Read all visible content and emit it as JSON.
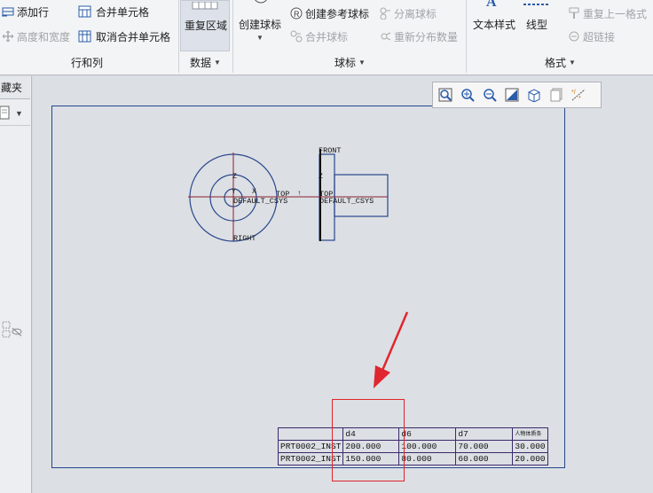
{
  "ribbon": {
    "rows_cols": {
      "add_row": "添加行",
      "height_width": "高度和宽度",
      "merge_cells": "合并单元格",
      "unmerge_cells": "取消合并单元格",
      "group_label": "行和列"
    },
    "data": {
      "repeat_region": "重复区域",
      "group_label": "数据"
    },
    "balloons": {
      "create_balloon": "创建球标",
      "create_ref_balloon": "创建参考球标",
      "merge_balloon": "合并球标",
      "detach_balloon": "分离球标",
      "redistribute_qty": "重新分布数量",
      "group_label": "球标"
    },
    "format": {
      "text_style": "文本样式",
      "line_style": "线型",
      "repeat_last_format": "重复上一格式",
      "hyperlink": "超链接",
      "group_label": "格式"
    }
  },
  "left_panel": {
    "tab_label": "藏夹"
  },
  "drawing": {
    "labels": {
      "front": "FRONT",
      "right": "RIGHT",
      "top": "TOP",
      "default_csys_left": "DEFAULT_CSYS",
      "default_csys_right": "DEFAULT_CSYS",
      "top_right_view": "TOP",
      "z_left": "Z",
      "z_right": "Z",
      "y_left": "Y",
      "x_left": "X"
    },
    "table": {
      "header": [
        "",
        "d4",
        "d6",
        "d7",
        "人物体质条"
      ],
      "rows": [
        [
          "PRT0002_INST",
          "200.000",
          "100.000",
          "70.000",
          "30.000"
        ],
        [
          "PRT0002_INST",
          "150.000",
          "80.000",
          "60.000",
          "20.000"
        ]
      ]
    }
  },
  "colors": {
    "frame_blue": "#27478c",
    "annotation_red": "#e0262f",
    "table_border": "#3a2a6a"
  }
}
